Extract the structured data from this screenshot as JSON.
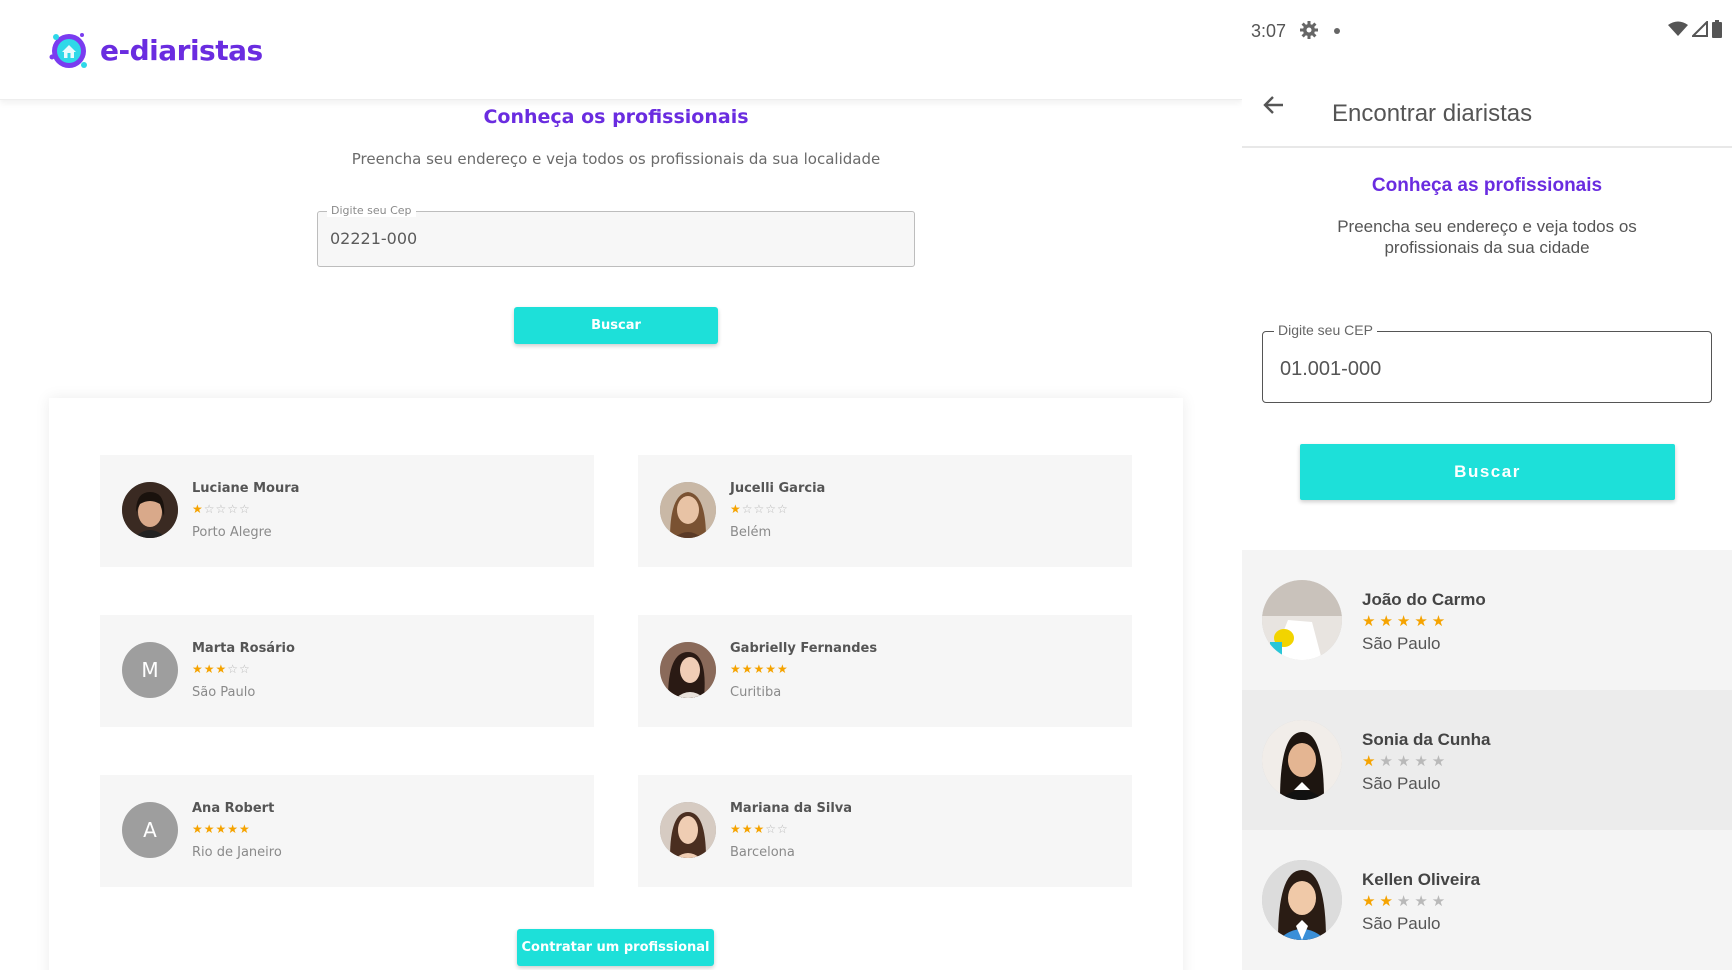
{
  "web": {
    "brand": "e-diaristas",
    "title": "Conheça os profissionais",
    "subtitle": "Preencha seu endereço e veja todos os profissionais da sua localidade",
    "cep_label": "Digite seu Cep",
    "cep_value": "02221-000",
    "search_button": "Buscar",
    "hire_button": "Contratar um profissional",
    "professionals": [
      {
        "name": "Luciane Moura",
        "rating": 1,
        "stars": "★☆☆☆☆",
        "city": "Porto Alegre",
        "avatar": "photo-woman-1"
      },
      {
        "name": "Jucelli Garcia",
        "rating": 1,
        "stars": "★☆☆☆☆",
        "city": "Belém",
        "avatar": "photo-woman-2"
      },
      {
        "name": "Marta Rosário",
        "rating": 3,
        "stars": "★★★☆☆",
        "city": "São Paulo",
        "avatar": "M"
      },
      {
        "name": "Gabrielly Fernandes",
        "rating": 5,
        "stars": "★★★★★",
        "city": "Curitiba",
        "avatar": "photo-woman-3"
      },
      {
        "name": "Ana Robert",
        "rating": 5,
        "stars": "★★★★★",
        "city": "Rio de Janeiro",
        "avatar": "A"
      },
      {
        "name": "Mariana da Silva",
        "rating": 3,
        "stars": "★★★☆☆",
        "city": "Barcelona",
        "avatar": "photo-woman-4"
      }
    ]
  },
  "mobile": {
    "status_time": "3:07",
    "appbar_title": "Encontrar diaristas",
    "title": "Conheça as profissionais",
    "subtitle": "Preencha seu endereço e veja todos os profissionais da sua cidade",
    "cep_label": "Digite seu CEP",
    "cep_value": "01.001-000",
    "search_button": "Buscar",
    "professionals": [
      {
        "name": "João do Carmo",
        "rating": 5,
        "stars": "★★★★★",
        "city": "São Paulo",
        "avatar": "photo-cleaning-hand"
      },
      {
        "name": "Sonia da Cunha",
        "rating": 1,
        "stars": "★★★★★",
        "city": "São Paulo",
        "avatar": "photo-maid"
      },
      {
        "name": "Kellen Oliveira",
        "rating": 2,
        "stars": "★★★★★",
        "city": "São Paulo",
        "avatar": "photo-woman-smile"
      }
    ]
  },
  "colors": {
    "brand_purple": "#6a2ce0",
    "accent_cyan": "#1de0d9",
    "star_gold": "#f5a300",
    "star_gray": "#b9b9b9"
  }
}
